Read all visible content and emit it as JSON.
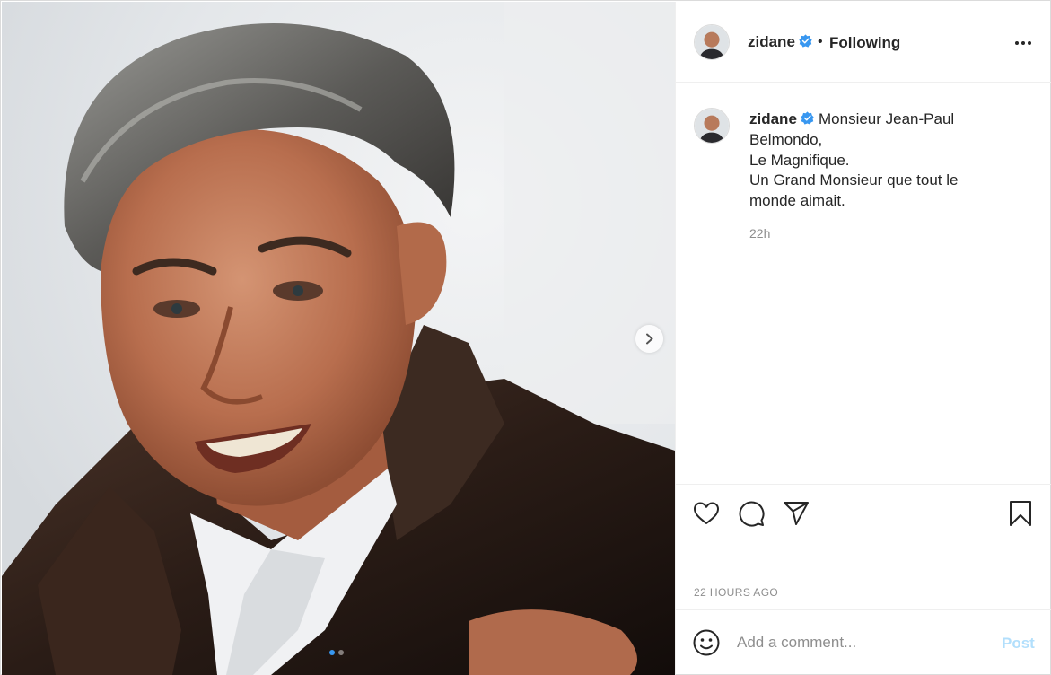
{
  "post": {
    "media": {
      "subject": "portrait photo",
      "next_icon": "chevron-right-icon",
      "carousel_dots": 2,
      "active_dot": 1
    },
    "header": {
      "username": "zidane",
      "verified_icon": "verified-badge-icon",
      "separator": "•",
      "follow_status": "Following",
      "more_icon": "more-options-icon"
    },
    "caption": {
      "username": "zidane",
      "first_line": "Monsieur Jean-Paul",
      "lines": [
        "Belmondo,",
        "Le Magnifique.",
        "Un Grand Monsieur que tout le",
        "monde aimait."
      ],
      "time": "22h"
    },
    "actions": {
      "icons": [
        "heart-icon",
        "comment-icon",
        "share-icon",
        "bookmark-icon"
      ],
      "posted": "22 HOURS AGO"
    },
    "comment_box": {
      "emoji_icon": "emoji-icon",
      "placeholder": "Add a comment...",
      "post_label": "Post"
    }
  },
  "colors": {
    "text": "#262626",
    "secondary": "#8e8e8e",
    "border": "#efefef",
    "verified": "#3897f0",
    "post_disabled": "#b2dffc"
  }
}
